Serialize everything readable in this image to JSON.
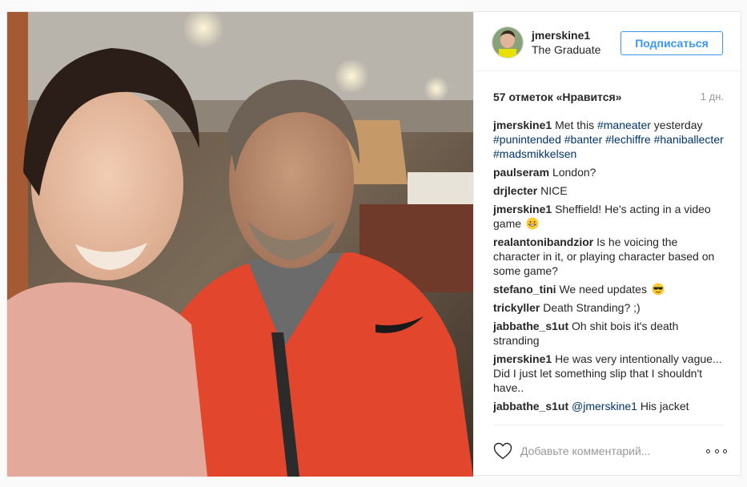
{
  "post": {
    "username": "jmerskine1",
    "location": "The Graduate",
    "follow_label": "Подписаться",
    "likes": "57 отметок «Нравится»",
    "age": "1 дн.",
    "caption": {
      "user": "jmerskine1",
      "text": "Met this",
      "hashtags": [
        "#maneater",
        "#punintended",
        "#banter",
        "#lechiffre",
        "#haniballecter",
        "#madsmikkelsen"
      ],
      "text_after_first_tag": "yesterday"
    }
  },
  "comments": [
    {
      "user": "paulseram",
      "text": "London?"
    },
    {
      "user": "drjlecter",
      "text": "NICE"
    },
    {
      "user": "jmerskine1",
      "text": "Sheffield! He's acting in a video game",
      "emoji": "grinning-face-icon"
    },
    {
      "user": "realantonibandzior",
      "text": "Is he voicing the character in it, or playing character based on some game?"
    },
    {
      "user": "stefano_tini",
      "text": "We need updates",
      "emoji": "sunglasses-face-icon"
    },
    {
      "user": "trickyller",
      "text": "Death Stranding? ;)"
    },
    {
      "user": "jabbathe_s1ut",
      "text": "Oh shit bois it's death stranding"
    },
    {
      "user": "jmerskine1",
      "text": "He was very intentionally vague... Did I just let something slip that I shouldn't have.."
    },
    {
      "user": "jabbathe_s1ut",
      "mention": "@jmerskine1",
      "text": "His jacket"
    }
  ],
  "footer": {
    "comment_placeholder": "Добавьте комментарий...",
    "like_icon": "heart-outline-icon",
    "more_icon": "more-options-icon"
  },
  "colors": {
    "link": "#003569",
    "follow_blue": "#3897f0",
    "muted": "#999999"
  }
}
